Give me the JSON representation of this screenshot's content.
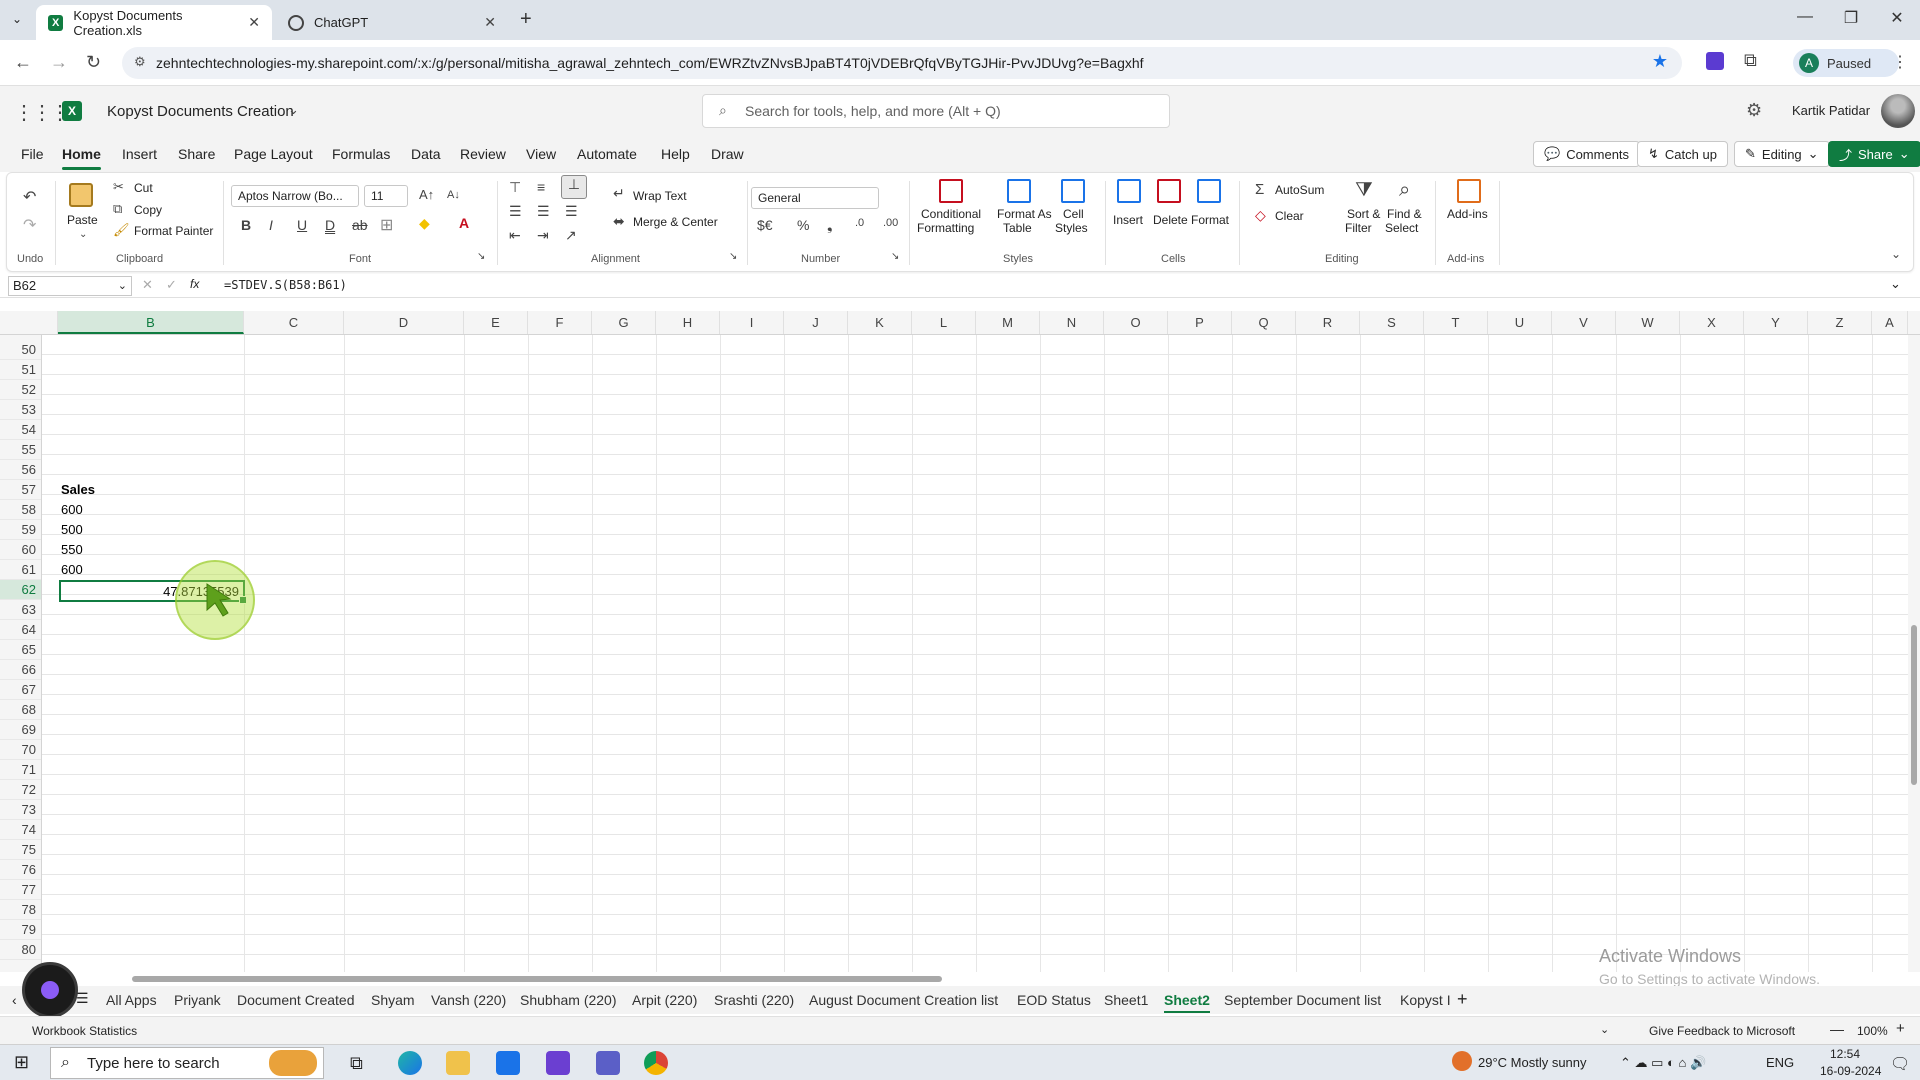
{
  "browser": {
    "tabs": [
      {
        "title": "Kopyst Documents Creation.xls"
      },
      {
        "title": "ChatGPT"
      }
    ],
    "url": "zehntechtechnologies-my.sharepoint.com/:x:/g/personal/mitisha_agrawal_zehntech_com/EWRZtvZNvsBJpaBT4T0jVDEBrQfqVByTGJHir-PvvJDUvg?e=Bagxhf",
    "profile_label": "Paused",
    "profile_initial": "A"
  },
  "excel": {
    "doc_name": "Kopyst Documents Creation",
    "search_placeholder": "Search for tools, help, and more (Alt + Q)",
    "user_name": "Kartik Patidar",
    "menus": [
      "File",
      "Home",
      "Insert",
      "Share",
      "Page Layout",
      "Formulas",
      "Data",
      "Review",
      "View",
      "Automate",
      "Help",
      "Draw"
    ],
    "actions": {
      "comments": "Comments",
      "catch_up": "Catch up",
      "editing": "Editing",
      "share": "Share"
    }
  },
  "ribbon": {
    "undo_group": "Undo",
    "paste": "Paste",
    "cut": "Cut",
    "copy": "Copy",
    "format_painter": "Format Painter",
    "clipboard_group": "Clipboard",
    "font_name": "Aptos Narrow (Bo...",
    "font_size": "11",
    "font_group": "Font",
    "wrap_text": "Wrap Text",
    "merge_center": "Merge & Center",
    "alignment_group": "Alignment",
    "number_format": "General",
    "number_group": "Number",
    "conditional_1": "Conditional",
    "conditional_2": "Formatting",
    "format_table_1": "Format As",
    "format_table_2": "Table",
    "cell_styles_1": "Cell",
    "cell_styles_2": "Styles",
    "styles_group": "Styles",
    "insert": "Insert",
    "delete": "Delete",
    "format": "Format",
    "cells_group": "Cells",
    "autosum": "AutoSum",
    "clear": "Clear",
    "sort_1": "Sort &",
    "sort_2": "Filter",
    "find_1": "Find &",
    "find_2": "Select",
    "editing_group": "Editing",
    "addins": "Add-ins",
    "addins_group": "Add-ins"
  },
  "formula_bar": {
    "name_box": "B62",
    "formula": "=STDEV.S(B58:B61)"
  },
  "grid": {
    "columns": [
      "B",
      "C",
      "D",
      "E",
      "F",
      "G",
      "H",
      "I",
      "J",
      "K",
      "L",
      "M",
      "N",
      "O",
      "P",
      "Q",
      "R",
      "S",
      "T",
      "U",
      "V",
      "W",
      "X",
      "Y",
      "Z",
      "A"
    ],
    "rows": [
      "50",
      "51",
      "52",
      "53",
      "54",
      "55",
      "56",
      "57",
      "58",
      "59",
      "60",
      "61",
      "62",
      "63",
      "64",
      "65",
      "66",
      "67",
      "68",
      "69",
      "70",
      "71",
      "72",
      "73",
      "74",
      "75",
      "76",
      "77",
      "78",
      "79",
      "80"
    ],
    "header_cell": "Sales",
    "values": [
      "600",
      "500",
      "550",
      "600"
    ],
    "result": "47.87135539"
  },
  "watermark": {
    "title": "Activate Windows",
    "subtitle": "Go to Settings to activate Windows."
  },
  "sheets": [
    "All Apps",
    "Priyank",
    "Document Created",
    "Shyam",
    "Vansh (220)",
    "Shubham (220)",
    "Arpit (220)",
    "Srashti (220)",
    "August Document Creation list",
    "EOD Status",
    "Sheet1",
    "Sheet2",
    "September Document list",
    "Kopyst I"
  ],
  "active_sheet": "Sheet2",
  "status": {
    "left": "Workbook Statistics",
    "feedback": "Give Feedback to Microsoft",
    "zoom": "100%"
  },
  "taskbar": {
    "search_placeholder": "Type here to search",
    "weather": "29°C  Mostly sunny",
    "lang": "ENG",
    "time": "12:54",
    "date": "16-09-2024"
  }
}
